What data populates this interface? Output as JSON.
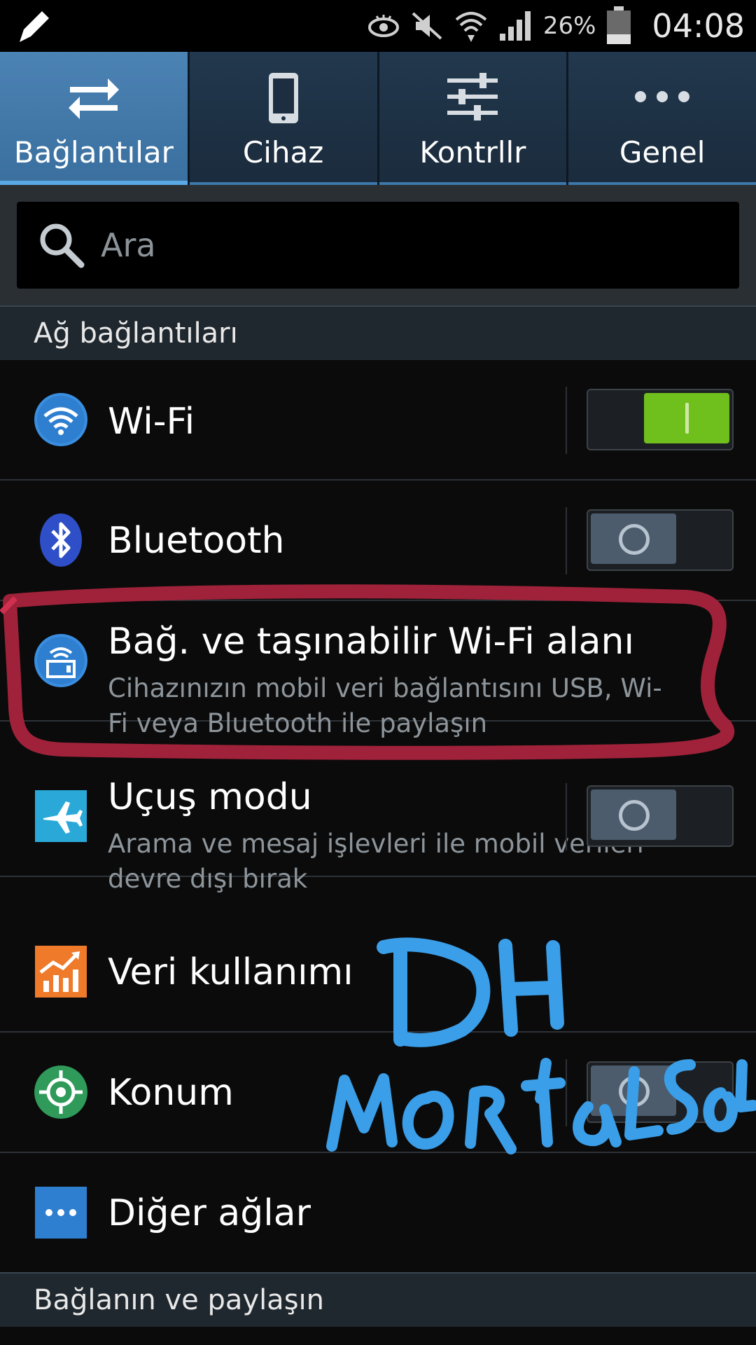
{
  "status_bar": {
    "battery_percent": "26%",
    "time": "04:08"
  },
  "tabs": [
    {
      "label": "Bağlantılar",
      "active": true,
      "icon": "swap-arrows-icon"
    },
    {
      "label": "Cihaz",
      "active": false,
      "icon": "phone-icon"
    },
    {
      "label": "Kontrllr",
      "active": false,
      "icon": "sliders-icon"
    },
    {
      "label": "Genel",
      "active": false,
      "icon": "more-dots-icon"
    }
  ],
  "search": {
    "placeholder": "Ara"
  },
  "sections": [
    {
      "header": "Ağ bağlantıları",
      "items": [
        {
          "title": "Wi-Fi",
          "icon": "wifi-icon",
          "toggle": "on"
        },
        {
          "title": "Bluetooth",
          "icon": "bluetooth-icon",
          "toggle": "off"
        },
        {
          "title": "Bağ. ve taşınabilir Wi-Fi alanı",
          "subtitle": "Cihazınızın mobil veri bağlantısını USB, Wi-Fi veya Bluetooth ile paylaşın",
          "icon": "hotspot-icon"
        },
        {
          "title": "Uçuş modu",
          "subtitle": "Arama ve mesaj işlevleri ile mobil verileri devre dışı bırak",
          "icon": "airplane-icon",
          "toggle": "off"
        },
        {
          "title": "Veri kullanımı",
          "icon": "data-usage-icon"
        },
        {
          "title": "Konum",
          "icon": "location-icon",
          "toggle": "off"
        },
        {
          "title": "Diğer ağlar",
          "icon": "more-networks-icon"
        }
      ]
    },
    {
      "header": "Bağlanın ve paylaşın"
    }
  ],
  "colors": {
    "accent_tab": "#3a6f9e",
    "toggle_on": "#6fbf1d",
    "annotation_red": "#a0223a",
    "annotation_blue": "#3a9ee8"
  }
}
